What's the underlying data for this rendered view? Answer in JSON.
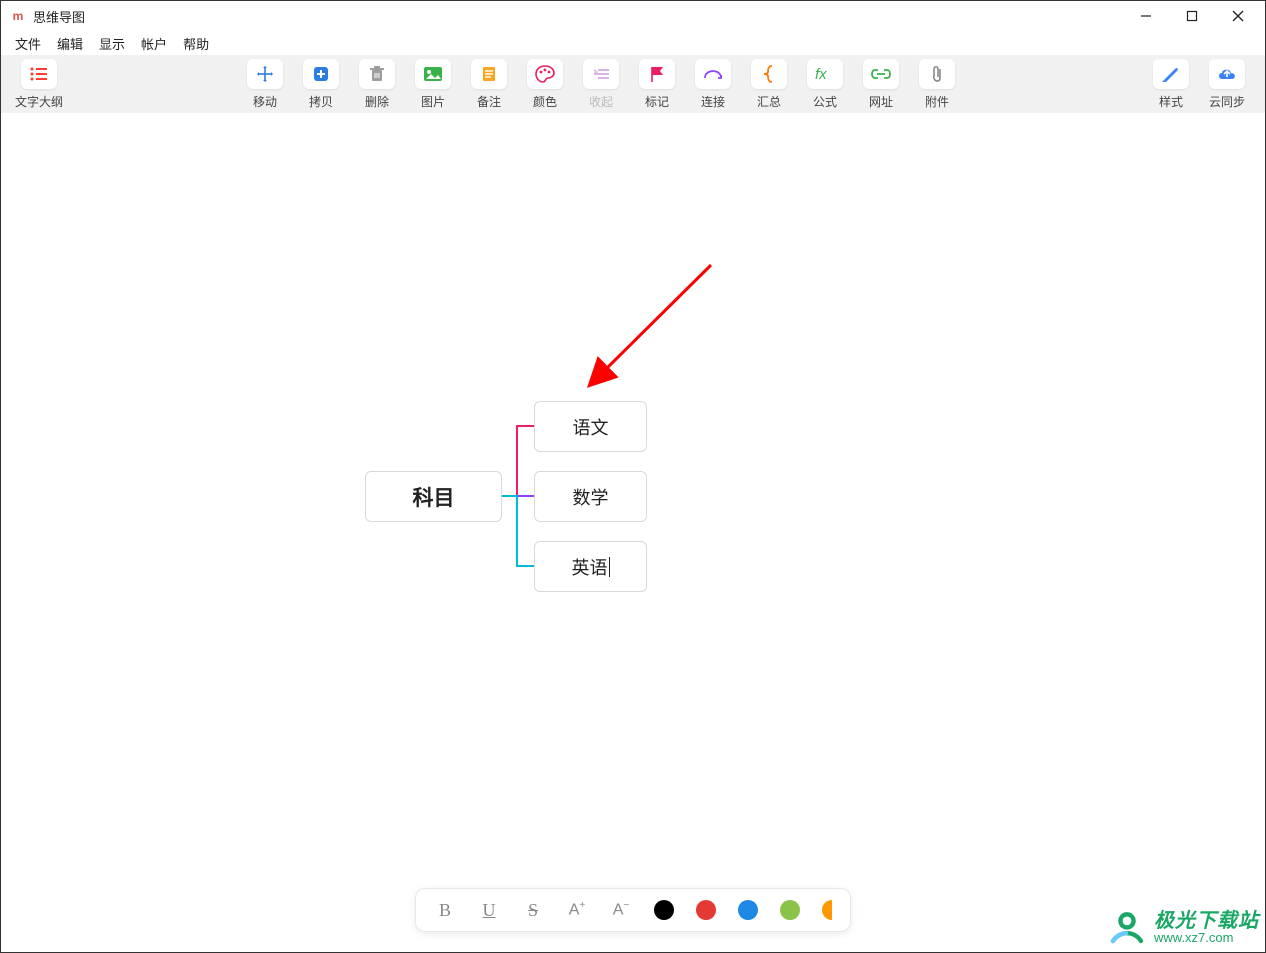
{
  "window": {
    "app_icon_letter": "m",
    "title": "思维导图"
  },
  "menu": {
    "file": "文件",
    "edit": "编辑",
    "view": "显示",
    "account": "帐户",
    "help": "帮助"
  },
  "toolbar": {
    "outline": "文字大纲",
    "move": "移动",
    "copy": "拷贝",
    "delete": "删除",
    "image": "图片",
    "note": "备注",
    "color": "颜色",
    "collapse": "收起",
    "marker": "标记",
    "connect": "连接",
    "summary": "汇总",
    "formula": "公式",
    "url": "网址",
    "attachment": "附件",
    "style": "样式",
    "cloud_sync": "云同步"
  },
  "mindmap": {
    "root": "科目",
    "child1": "语文",
    "child2": "数学",
    "child3": "英语"
  },
  "formatbar": {
    "bold": "B",
    "underline": "U",
    "strike": "S",
    "increase": "A",
    "decrease": "A",
    "colors": [
      "#000000",
      "#e53935",
      "#1e88e5",
      "#8bc34a",
      "#ff9800"
    ]
  },
  "watermark": {
    "cn": "极光下载站",
    "url": "www.xz7.com"
  }
}
